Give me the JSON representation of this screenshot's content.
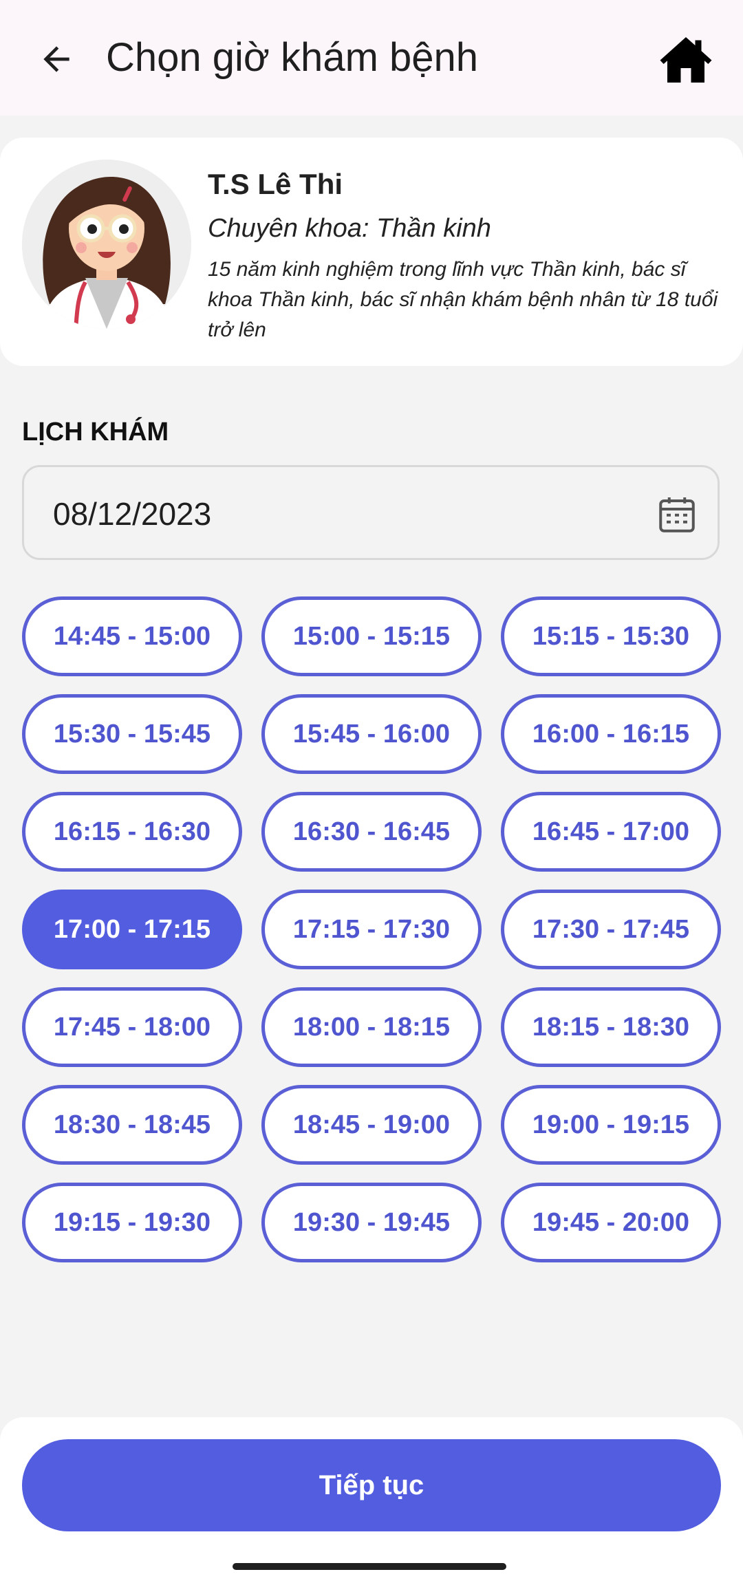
{
  "header": {
    "title": "Chọn giờ khám bệnh",
    "back_icon": "arrow-left-icon",
    "home_icon": "home-icon"
  },
  "doctor": {
    "name": "T.S Lê Thi",
    "specialty": "Chuyên khoa: Thần kinh",
    "description": "15 năm kinh nghiệm trong lĩnh vực Thần kinh, bác sĩ khoa Thần kinh, bác sĩ nhận khám bệnh nhân từ 18 tuổi trở lên",
    "avatar_icon": "doctor-avatar"
  },
  "schedule": {
    "section_title": "LỊCH KHÁM",
    "date": "08/12/2023",
    "calendar_icon": "calendar-icon",
    "selected_slot": "17:00 - 17:15",
    "slots": [
      "14:45 - 15:00",
      "15:00 - 15:15",
      "15:15 - 15:30",
      "15:30 - 15:45",
      "15:45 - 16:00",
      "16:00 - 16:15",
      "16:15 - 16:30",
      "16:30 - 16:45",
      "16:45 - 17:00",
      "17:00 - 17:15",
      "17:15 - 17:30",
      "17:30 - 17:45",
      "17:45 - 18:00",
      "18:00 - 18:15",
      "18:15 - 18:30",
      "18:30 - 18:45",
      "18:45 - 19:00",
      "19:00 - 19:15",
      "19:15 - 19:30",
      "19:30 - 19:45",
      "19:45 - 20:00"
    ]
  },
  "footer": {
    "continue_label": "Tiếp tục"
  },
  "colors": {
    "accent": "#535ddf",
    "slot_text": "#4f55cf",
    "background": "#f3f3f3",
    "appbar": "#fcf6fb"
  }
}
